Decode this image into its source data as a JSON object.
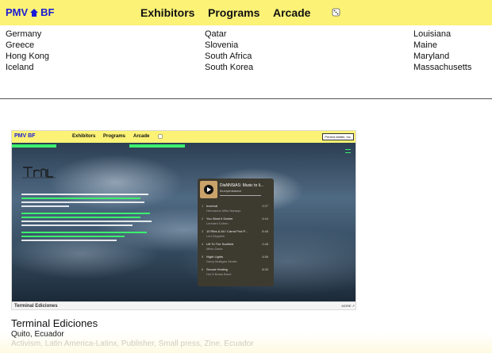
{
  "header": {
    "logo_left": "PMV",
    "logo_right": "BF",
    "nav": [
      "Exhibitors",
      "Programs",
      "Arcade"
    ],
    "brand_color": "#1b1bd6",
    "bar_color": "#fbf276"
  },
  "lists": {
    "col1": [
      "Germany",
      "Greece",
      "Hong Kong",
      "Iceland"
    ],
    "col2": [
      "Qatar",
      "Slovenia",
      "South Africa",
      "South Korea"
    ],
    "col3": [
      "Louisiana",
      "Maine",
      "Maryland",
      "Massachusetts"
    ]
  },
  "preview": {
    "mini_logo": "PMV BF",
    "mini_nav": [
      "Exhibitors",
      "Programs",
      "Arcade"
    ],
    "mini_sign": "Printed Matter, Inc.",
    "player": {
      "title": "DiaNNSiAS: Music to li...",
      "subtitle": "thumpedstance",
      "tracks": [
        {
          "n": "1",
          "name": "Invernal",
          "artist": "Hermanos Miño Naranjo",
          "dur": "2:27"
        },
        {
          "n": "2",
          "name": "You Want It Darker",
          "artist": "Leonard Cohen",
          "dur": "4:44"
        },
        {
          "n": "3",
          "name": "10 Ribs & All / Carrot Pod P...",
          "artist": "Led Zeppelin",
          "dur": "6:48"
        },
        {
          "n": "4",
          "name": "Lift To The Scaffold",
          "artist": "Miles Davis",
          "dur": "2:48"
        },
        {
          "n": "5",
          "name": "Night Lights",
          "artist": "Gerry Mulligan Sextet",
          "dur": "4:56"
        },
        {
          "n": "6",
          "name": "Sexual Healing",
          "artist": "Hot 8 Brass Band",
          "dur": "8:33"
        }
      ]
    },
    "foot_name": "Terminal Ediciones",
    "foot_more": "MORE ↗"
  },
  "exhibitor": {
    "name": "Terminal Ediciones",
    "location": "Quito, Ecuador",
    "tags": "Activism, Latin America-Latinx, Publisher, Small press, Zine, Ecuador"
  }
}
